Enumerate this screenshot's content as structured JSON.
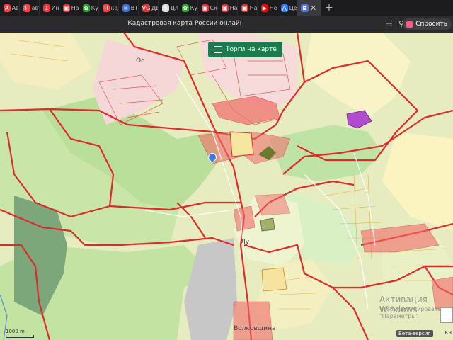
{
  "tabs": [
    {
      "label": "Авт",
      "color": "#ff4141",
      "glyph": "A"
    },
    {
      "label": "авт",
      "color": "#ff4141",
      "glyph": "Я"
    },
    {
      "label": "Ин",
      "color": "#e83a3a",
      "glyph": "1"
    },
    {
      "label": "На",
      "color": "#d33",
      "glyph": "▣"
    },
    {
      "label": "Ку",
      "color": "#2ca02c",
      "glyph": "✿"
    },
    {
      "label": "кад",
      "color": "#ff4141",
      "glyph": "Я"
    },
    {
      "label": "ВТ",
      "color": "#3b6fd8",
      "glyph": "≡"
    },
    {
      "label": "Дв",
      "color": "#d33",
      "glyph": "VG"
    },
    {
      "label": "Дл",
      "color": "#ddd",
      "glyph": "✦"
    },
    {
      "label": "Ку",
      "color": "#2ca02c",
      "glyph": "✿"
    },
    {
      "label": "Ск",
      "color": "#d33",
      "glyph": "▣"
    },
    {
      "label": "На",
      "color": "#d33",
      "glyph": "▣"
    },
    {
      "label": "На",
      "color": "#d33",
      "glyph": "▣"
    },
    {
      "label": "Не",
      "color": "#ff0000",
      "glyph": "▶"
    },
    {
      "label": "Це",
      "color": "#2e7dff",
      "glyph": "⋀"
    }
  ],
  "active_tab": {
    "color": "#4b78ff",
    "glyph": "◘",
    "close": "✕"
  },
  "new_tab_glyph": "+",
  "title": "Кадастровая карта России онлайн",
  "ask_label": "Спросить",
  "auction_label": "Торги на карте",
  "places": {
    "p1": "Ос",
    "p2": "Лу",
    "p3": "Волковщина"
  },
  "scale_label": "1000 m",
  "beta_label": "Бета-версия",
  "watermark": {
    "line1": "Активация Windows",
    "line2": "Чтобы активировать",
    "line3": "\"Параметры\""
  },
  "keys_label": "Кн"
}
